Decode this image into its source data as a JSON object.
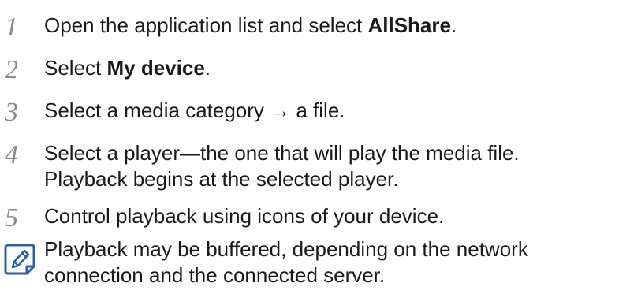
{
  "steps": [
    {
      "number": "1",
      "pre": "Open the application list and select ",
      "bold": "AllShare",
      "post": "."
    },
    {
      "number": "2",
      "pre": "Select ",
      "bold": "My device",
      "post": "."
    },
    {
      "number": "3",
      "text": "Select a media category → a file."
    },
    {
      "number": "4",
      "line1": "Select a player—the one that will play the media file.",
      "line2": "Playback begins at the selected player."
    },
    {
      "number": "5",
      "text": "Control playback using icons of your device."
    }
  ],
  "note": {
    "icon": "note-pencil-icon",
    "line1": "Playback may be buffered, depending on the network",
    "line2": "connection and the connected server."
  }
}
